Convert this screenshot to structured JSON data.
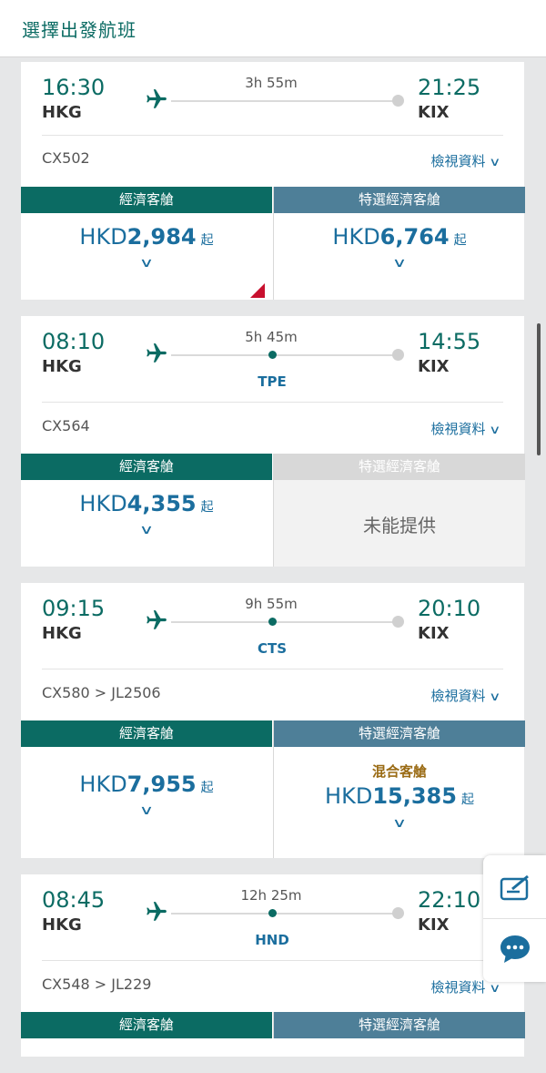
{
  "header": {
    "title": "選擇出發航班"
  },
  "flights": [
    {
      "dep_time": "16:30",
      "dep_code": "HKG",
      "arr_time": "21:25",
      "arr_code": "KIX",
      "duration": "3h 55m",
      "stop": "",
      "flight_no": "CX502",
      "details": "檢視資料",
      "economy": {
        "label": "經濟客艙",
        "currency": "HKD",
        "amount": "2,984",
        "suffix": "起"
      },
      "premium": {
        "label": "特選經濟客艙",
        "currency": "HKD",
        "amount": "6,764",
        "suffix": "起"
      }
    },
    {
      "dep_time": "08:10",
      "dep_code": "HKG",
      "arr_time": "14:55",
      "arr_code": "KIX",
      "duration": "5h 45m",
      "stop": "TPE",
      "flight_no": "CX564",
      "details": "檢視資料",
      "economy": {
        "label": "經濟客艙",
        "currency": "HKD",
        "amount": "4,355",
        "suffix": "起"
      },
      "premium": {
        "label": "特選經濟客艙",
        "unavailable": "未能提供"
      }
    },
    {
      "dep_time": "09:15",
      "dep_code": "HKG",
      "arr_time": "20:10",
      "arr_code": "KIX",
      "duration": "9h 55m",
      "stop": "CTS",
      "flight_no": "CX580 > JL2506",
      "details": "檢視資料",
      "economy": {
        "label": "經濟客艙",
        "currency": "HKD",
        "amount": "7,955",
        "suffix": "起"
      },
      "premium": {
        "label": "特選經濟客艙",
        "mixed": "混合客艙",
        "currency": "HKD",
        "amount": "15,385",
        "suffix": "起"
      }
    },
    {
      "dep_time": "08:45",
      "dep_code": "HKG",
      "arr_time": "22:10",
      "arr_code": "KIX",
      "duration": "12h 25m",
      "stop": "HND",
      "flight_no": "CX548 > JL229",
      "details": "檢視資料",
      "economy": {
        "label": "經濟客艙"
      },
      "premium": {
        "label": "特選經濟客艙"
      }
    }
  ],
  "icons": {
    "plane": "plane-icon",
    "feedback": "feedback-icon",
    "chat": "chat-icon"
  },
  "colors": {
    "primary": "#0b6b63",
    "premium": "#4e7f98",
    "link": "#1b6e9e",
    "mixed": "#9a6b14",
    "alert": "#c8102e"
  }
}
